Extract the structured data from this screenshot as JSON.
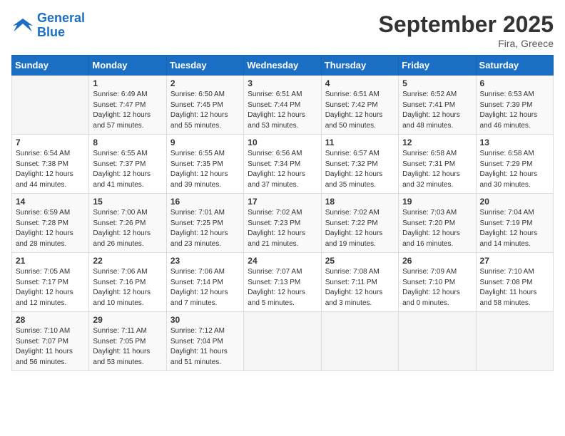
{
  "logo": {
    "line1": "General",
    "line2": "Blue"
  },
  "title": "September 2025",
  "location": "Fira, Greece",
  "days_of_week": [
    "Sunday",
    "Monday",
    "Tuesday",
    "Wednesday",
    "Thursday",
    "Friday",
    "Saturday"
  ],
  "weeks": [
    [
      {
        "day": "",
        "info": ""
      },
      {
        "day": "1",
        "info": "Sunrise: 6:49 AM\nSunset: 7:47 PM\nDaylight: 12 hours\nand 57 minutes."
      },
      {
        "day": "2",
        "info": "Sunrise: 6:50 AM\nSunset: 7:45 PM\nDaylight: 12 hours\nand 55 minutes."
      },
      {
        "day": "3",
        "info": "Sunrise: 6:51 AM\nSunset: 7:44 PM\nDaylight: 12 hours\nand 53 minutes."
      },
      {
        "day": "4",
        "info": "Sunrise: 6:51 AM\nSunset: 7:42 PM\nDaylight: 12 hours\nand 50 minutes."
      },
      {
        "day": "5",
        "info": "Sunrise: 6:52 AM\nSunset: 7:41 PM\nDaylight: 12 hours\nand 48 minutes."
      },
      {
        "day": "6",
        "info": "Sunrise: 6:53 AM\nSunset: 7:39 PM\nDaylight: 12 hours\nand 46 minutes."
      }
    ],
    [
      {
        "day": "7",
        "info": "Sunrise: 6:54 AM\nSunset: 7:38 PM\nDaylight: 12 hours\nand 44 minutes."
      },
      {
        "day": "8",
        "info": "Sunrise: 6:55 AM\nSunset: 7:37 PM\nDaylight: 12 hours\nand 41 minutes."
      },
      {
        "day": "9",
        "info": "Sunrise: 6:55 AM\nSunset: 7:35 PM\nDaylight: 12 hours\nand 39 minutes."
      },
      {
        "day": "10",
        "info": "Sunrise: 6:56 AM\nSunset: 7:34 PM\nDaylight: 12 hours\nand 37 minutes."
      },
      {
        "day": "11",
        "info": "Sunrise: 6:57 AM\nSunset: 7:32 PM\nDaylight: 12 hours\nand 35 minutes."
      },
      {
        "day": "12",
        "info": "Sunrise: 6:58 AM\nSunset: 7:31 PM\nDaylight: 12 hours\nand 32 minutes."
      },
      {
        "day": "13",
        "info": "Sunrise: 6:58 AM\nSunset: 7:29 PM\nDaylight: 12 hours\nand 30 minutes."
      }
    ],
    [
      {
        "day": "14",
        "info": "Sunrise: 6:59 AM\nSunset: 7:28 PM\nDaylight: 12 hours\nand 28 minutes."
      },
      {
        "day": "15",
        "info": "Sunrise: 7:00 AM\nSunset: 7:26 PM\nDaylight: 12 hours\nand 26 minutes."
      },
      {
        "day": "16",
        "info": "Sunrise: 7:01 AM\nSunset: 7:25 PM\nDaylight: 12 hours\nand 23 minutes."
      },
      {
        "day": "17",
        "info": "Sunrise: 7:02 AM\nSunset: 7:23 PM\nDaylight: 12 hours\nand 21 minutes."
      },
      {
        "day": "18",
        "info": "Sunrise: 7:02 AM\nSunset: 7:22 PM\nDaylight: 12 hours\nand 19 minutes."
      },
      {
        "day": "19",
        "info": "Sunrise: 7:03 AM\nSunset: 7:20 PM\nDaylight: 12 hours\nand 16 minutes."
      },
      {
        "day": "20",
        "info": "Sunrise: 7:04 AM\nSunset: 7:19 PM\nDaylight: 12 hours\nand 14 minutes."
      }
    ],
    [
      {
        "day": "21",
        "info": "Sunrise: 7:05 AM\nSunset: 7:17 PM\nDaylight: 12 hours\nand 12 minutes."
      },
      {
        "day": "22",
        "info": "Sunrise: 7:06 AM\nSunset: 7:16 PM\nDaylight: 12 hours\nand 10 minutes."
      },
      {
        "day": "23",
        "info": "Sunrise: 7:06 AM\nSunset: 7:14 PM\nDaylight: 12 hours\nand 7 minutes."
      },
      {
        "day": "24",
        "info": "Sunrise: 7:07 AM\nSunset: 7:13 PM\nDaylight: 12 hours\nand 5 minutes."
      },
      {
        "day": "25",
        "info": "Sunrise: 7:08 AM\nSunset: 7:11 PM\nDaylight: 12 hours\nand 3 minutes."
      },
      {
        "day": "26",
        "info": "Sunrise: 7:09 AM\nSunset: 7:10 PM\nDaylight: 12 hours\nand 0 minutes."
      },
      {
        "day": "27",
        "info": "Sunrise: 7:10 AM\nSunset: 7:08 PM\nDaylight: 11 hours\nand 58 minutes."
      }
    ],
    [
      {
        "day": "28",
        "info": "Sunrise: 7:10 AM\nSunset: 7:07 PM\nDaylight: 11 hours\nand 56 minutes."
      },
      {
        "day": "29",
        "info": "Sunrise: 7:11 AM\nSunset: 7:05 PM\nDaylight: 11 hours\nand 53 minutes."
      },
      {
        "day": "30",
        "info": "Sunrise: 7:12 AM\nSunset: 7:04 PM\nDaylight: 11 hours\nand 51 minutes."
      },
      {
        "day": "",
        "info": ""
      },
      {
        "day": "",
        "info": ""
      },
      {
        "day": "",
        "info": ""
      },
      {
        "day": "",
        "info": ""
      }
    ]
  ]
}
